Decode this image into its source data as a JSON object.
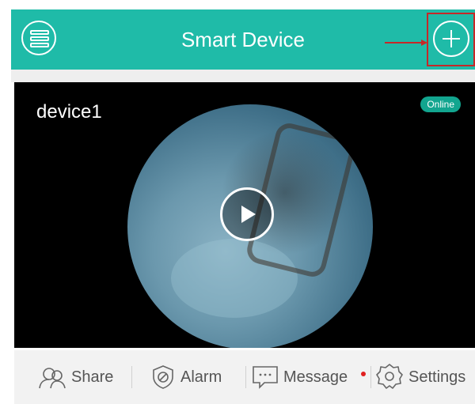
{
  "header": {
    "title": "Smart Device",
    "menu_icon": "menu-icon",
    "add_icon": "plus-icon",
    "accent_color": "#1fbba8",
    "highlight_color": "#c62828"
  },
  "device": {
    "name": "device1",
    "status": "Online",
    "play_icon": "play-icon"
  },
  "toolbar": {
    "share_label": "Share",
    "alarm_label": "Alarm",
    "message_label": "Message",
    "settings_label": "Settings",
    "message_has_unread": true
  }
}
